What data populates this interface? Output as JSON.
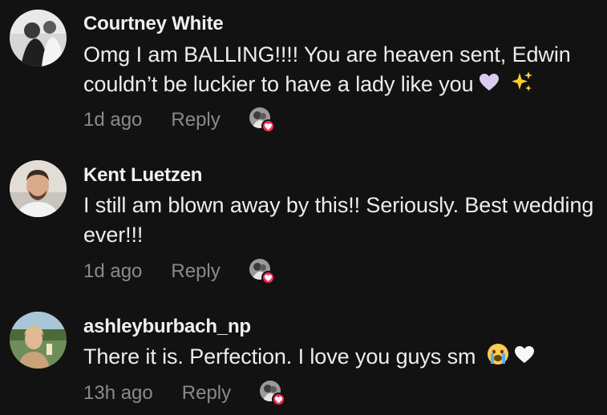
{
  "comments": [
    {
      "username": "Courtney White",
      "text": "Omg I am BALLING!!!! You are heaven sent, Edwin couldn’t be luckier to have a lady like you",
      "emojis": [
        "light-purple-heart-icon",
        "sparkles-icon"
      ],
      "time": "1d ago",
      "reply_label": "Reply"
    },
    {
      "username": "Kent Luetzen",
      "text": "I still am blown away by this!! Seriously. Best wedding ever!!!",
      "emojis": [],
      "time": "1d ago",
      "reply_label": "Reply"
    },
    {
      "username": "ashleyburbach_np",
      "text": "There it is. Perfection. I love you guys sm",
      "emojis": [
        "crying-face-icon",
        "white-heart-icon"
      ],
      "time": "13h ago",
      "reply_label": "Reply"
    }
  ],
  "colors": {
    "background": "#121212",
    "text": "#ededed",
    "muted": "#8a8a8a",
    "like_badge": "#fe2c55"
  }
}
